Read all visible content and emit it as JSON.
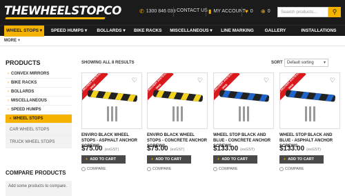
{
  "header": {
    "logo": "THEWHEELSTOPCO",
    "phone": "1300 846 039",
    "contact": "CONTACT US",
    "account": "MY ACCOUNT",
    "wishlist_count": "0",
    "cart_count": "0",
    "search_placeholder": "Search products..."
  },
  "nav": {
    "items": [
      {
        "label": "WHEEL STOPS",
        "active": true
      },
      {
        "label": "SPEED HUMPS"
      },
      {
        "label": "BOLLARDS"
      },
      {
        "label": "BIKE RACKS"
      },
      {
        "label": "MISCELLANEOUS"
      },
      {
        "label": "LINE MARKING"
      },
      {
        "label": "GALLERY"
      },
      {
        "label": "INSTALLATIONS"
      }
    ]
  },
  "breadcrumb": {
    "more": "MORE +"
  },
  "sidebar": {
    "title": "PRODUCTS",
    "items": [
      {
        "label": "CONVEX MIRRORS"
      },
      {
        "label": "BIKE RACKS"
      },
      {
        "label": "BOLLARDS"
      },
      {
        "label": "MISCELLANEOUS"
      },
      {
        "label": "SPEED HUMPS"
      },
      {
        "label": "WHEEL STOPS",
        "active": true
      }
    ],
    "subitems": [
      {
        "label": "CAR WHEEL STOPS"
      },
      {
        "label": "TRUCK WHEEL STOPS"
      }
    ],
    "compare_title": "COMPARE PRODUCTS",
    "compare_text": "Add some products to compare."
  },
  "main": {
    "showing": "SHOWING ALL 8 RESULTS",
    "sort_label": "SORT",
    "sort_value": "Default sorting",
    "products": [
      {
        "name": "ENVIRO BLACK WHEEL STOPS - ASPHALT ANCHOR SCREWS",
        "price": "$75.00",
        "gst": "(exGST)",
        "cart": "ADD TO CART",
        "compare": "COMPARE",
        "ribbon": "FREE DELIVERY AUSTRALIA WIDE",
        "color": "#f2d21e"
      },
      {
        "name": "ENVIRO BLACK WHEEL STOPS - CONCRETE ANCHOR SCREWS",
        "price": "$75.00",
        "gst": "(exGST)",
        "cart": "ADD TO CART",
        "compare": "COMPARE",
        "ribbon": "FREE DELIVERY AUSTRALIA WIDE",
        "color": "#f2d21e"
      },
      {
        "name": "WHEEL STOP BLACK AND BLUE - CONCRETE ANCHOR SCREWS",
        "price": "$133.00",
        "gst": "(exGST)",
        "cart": "ADD TO CART",
        "compare": "COMPARE",
        "ribbon": "FREE DELIVERY AUSTRALIA WIDE",
        "color": "#1f64c8"
      },
      {
        "name": "WHEEL STOP BLACK AND BLUE - ASPHALT ANCHOR SCREWS",
        "price": "$133.00",
        "gst": "(exGST)",
        "cart": "ADD TO CART",
        "compare": "COMPARE",
        "ribbon": "FREE DELIVERY AUSTRALIA WIDE",
        "color": "#1f64c8"
      }
    ]
  }
}
